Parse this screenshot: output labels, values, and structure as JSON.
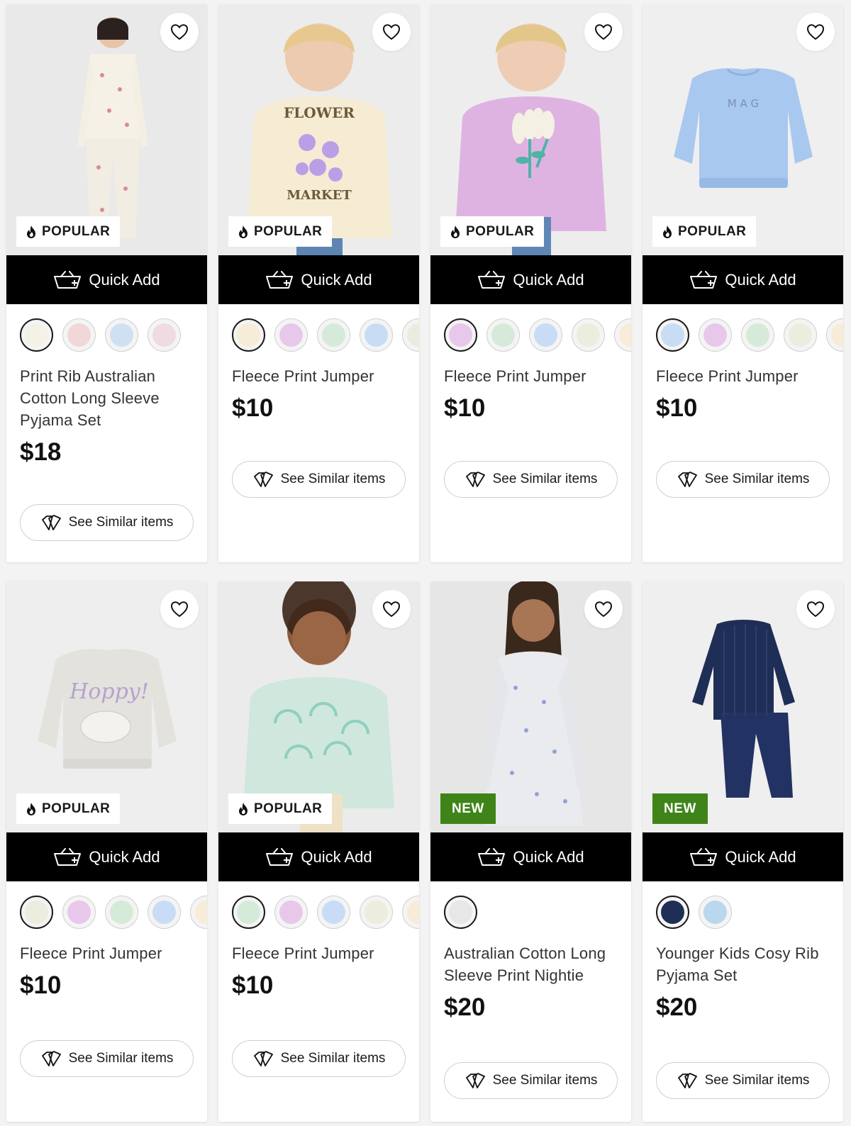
{
  "labels": {
    "quick_add": "Quick Add",
    "see_similar": "See Similar items",
    "popular": "POPULAR",
    "new": "NEW"
  },
  "colors": {
    "new_badge": "#3f8419",
    "quick_add_bg": "#000000"
  },
  "products": [
    {
      "title": "Print Rib Australian Cotton Long Sleeve Pyjama Set",
      "price": "$18",
      "badge": "popular",
      "art": "girl-pyjama",
      "swatches": [
        "#f4f1e6",
        "#f2d7d8",
        "#cfe0f3",
        "#f0dbe2"
      ]
    },
    {
      "title": "Fleece Print Jumper",
      "price": "$10",
      "badge": "popular",
      "art": "girl-flower-cream",
      "swatches": [
        "#f6ecd7",
        "#e8c8ea",
        "#d6ead9",
        "#c9dcf5",
        "#e9eddf"
      ]
    },
    {
      "title": "Fleece Print Jumper",
      "price": "$10",
      "badge": "popular",
      "art": "girl-lilac",
      "swatches": [
        "#e8c8ea",
        "#d6ead9",
        "#c9dcf5",
        "#ededdf",
        "#f6ecd7"
      ]
    },
    {
      "title": "Fleece Print Jumper",
      "price": "$10",
      "badge": "popular",
      "art": "blue-jumper",
      "swatches": [
        "#c9dcf5",
        "#e8c8ea",
        "#d6ead9",
        "#ededdf",
        "#f6ecd7"
      ]
    },
    {
      "title": "Fleece Print Jumper",
      "price": "$10",
      "badge": "popular",
      "art": "grey-jumper",
      "swatches": [
        "#ececdf",
        "#e8c8ea",
        "#d6ead9",
        "#c9dcf5",
        "#f6ecd7"
      ]
    },
    {
      "title": "Fleece Print Jumper",
      "price": "$10",
      "badge": "popular",
      "art": "girl-mint",
      "swatches": [
        "#d6ead9",
        "#e8c8ea",
        "#c9dcf5",
        "#ececdf",
        "#f6ecd7"
      ]
    },
    {
      "title": "Australian Cotton Long Sleeve Print Nightie",
      "price": "$20",
      "badge": "new",
      "art": "woman-nightie",
      "swatches": [
        "#e7e7e7"
      ]
    },
    {
      "title": "Younger Kids Cosy Rib Pyjama Set",
      "price": "$20",
      "badge": "new",
      "art": "navy-pyjama",
      "swatches": [
        "#1f2e57",
        "#b9d8ee"
      ]
    }
  ]
}
